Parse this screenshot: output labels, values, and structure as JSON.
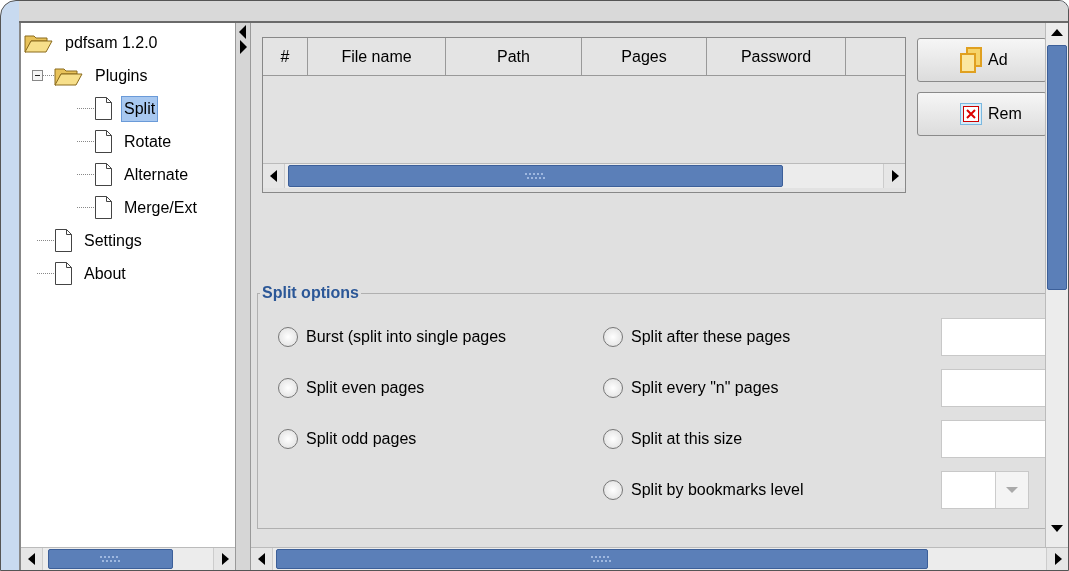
{
  "tree": [
    {
      "label": "pdfsam 1.2.0",
      "kind": "folder",
      "expanded": true,
      "selected": false,
      "children": [
        {
          "label": "Plugins",
          "kind": "folder",
          "expanded": true,
          "selected": false,
          "children": [
            {
              "label": "Split",
              "kind": "page",
              "selected": true
            },
            {
              "label": "Rotate",
              "kind": "page",
              "selected": false
            },
            {
              "label": "Alternate",
              "kind": "page",
              "selected": false
            },
            {
              "label": "Merge/Ext",
              "kind": "page",
              "selected": false
            }
          ]
        },
        {
          "label": "Settings",
          "kind": "page",
          "selected": false
        },
        {
          "label": "About",
          "kind": "page",
          "selected": false
        }
      ]
    }
  ],
  "table": {
    "columns": [
      "#",
      "File name",
      "Path",
      "Pages",
      "Password"
    ]
  },
  "buttons": [
    {
      "label": "Ad",
      "kind": "add"
    },
    {
      "label": "Rem",
      "kind": "remove"
    }
  ],
  "split_options": {
    "title": "Split options",
    "left": [
      {
        "label": "Burst (split into single pages",
        "selected": false
      },
      {
        "label": "Split even pages",
        "selected": false
      },
      {
        "label": "Split odd pages",
        "selected": false
      }
    ],
    "right": [
      {
        "label": "Split after these pages",
        "selected": false,
        "kind": "text"
      },
      {
        "label": "Split every \"n\" pages",
        "selected": false,
        "kind": "text"
      },
      {
        "label": "Split at this size",
        "selected": false,
        "kind": "text"
      },
      {
        "label": "Split by bookmarks level",
        "selected": false,
        "kind": "combo"
      }
    ]
  }
}
